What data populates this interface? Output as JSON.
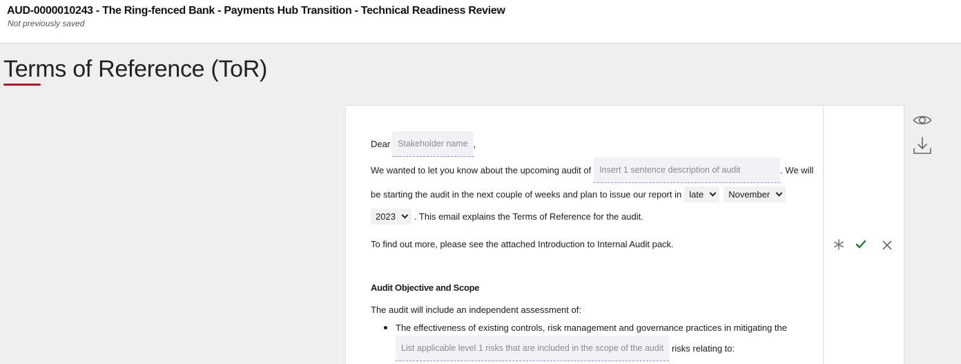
{
  "header": {
    "title": "AUD-0000010243 - The Ring-fenced Bank - Payments Hub Transition - Technical Readiness Review",
    "status": "Not previously saved"
  },
  "page": {
    "heading": "Terms of Reference (ToR)"
  },
  "letter": {
    "greeting": "Dear",
    "greeting_comma": ",",
    "stakeholder_placeholder": "Stakeholder name",
    "line2_prefix": "We wanted to let you know about the upcoming audit of",
    "description_placeholder": "Insert 1 sentence description of audit",
    "line2_suffix": ". We will",
    "line3_prefix": "be starting the audit in the next couple of weeks and plan to issue our report in",
    "timing_select": "late",
    "month_select": "November",
    "year_select": "2023",
    "line4_suffix": ". This email explains the Terms of Reference for the audit.",
    "line5": "To find out more, please see the attached Introduction to Internal Audit pack.",
    "section_heading": "Audit Objective and Scope",
    "scope_intro": "The audit will include an independent assessment of:",
    "bullet1": "The effectiveness of existing controls, risk management and governance practices in mitigating the",
    "risks_placeholder": "List applicable level 1 risks that are included in the scope of the audit",
    "bullet1_suffix": "risks relating to:"
  },
  "actions": {
    "icons": [
      "eye-icon",
      "download-icon",
      "asterisk-icon",
      "check-icon",
      "close-icon"
    ],
    "accept_color": "#1a7f2e",
    "accent_color": "#e2001a"
  }
}
